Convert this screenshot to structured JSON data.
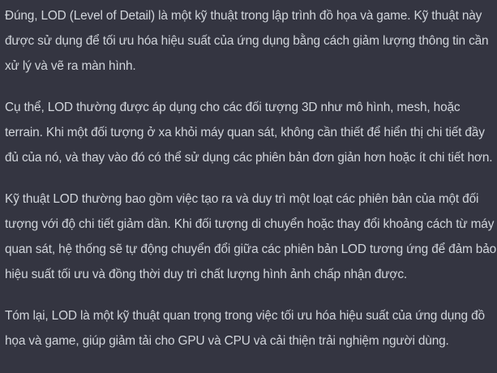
{
  "assistant_message": {
    "paragraphs": [
      "Đúng, LOD (Level of Detail) là một kỹ thuật trong lập trình đồ họa và game. Kỹ thuật này được sử dụng để tối ưu hóa hiệu suất của ứng dụng bằng cách giảm lượng thông tin cần xử lý và vẽ ra màn hình.",
      "Cụ thể, LOD thường được áp dụng cho các đối tượng 3D như mô hình, mesh, hoặc terrain. Khi một đối tượng ở xa khỏi máy quan sát, không cần thiết để hiển thị chi tiết đầy đủ của nó, và thay vào đó có thể sử dụng các phiên bản đơn giản hơn hoặc ít chi tiết hơn.",
      "Kỹ thuật LOD thường bao gồm việc tạo ra và duy trì một loạt các phiên bản của một đối tượng với độ chi tiết giảm dần. Khi đối tượng di chuyển hoặc thay đổi khoảng cách từ máy quan sát, hệ thống sẽ tự động chuyển đổi giữa các phiên bản LOD tương ứng để đảm bảo hiệu suất tối ưu và đồng thời duy trì chất lượng hình ảnh chấp nhận được.",
      "Tóm lại, LOD là một kỹ thuật quan trọng trong việc tối ưu hóa hiệu suất của ứng dụng đồ họa và game, giúp giảm tải cho GPU và CPU và cải thiện trải nghiệm người dùng."
    ]
  },
  "colors": {
    "background": "#343541",
    "text": "#d1d5db"
  }
}
